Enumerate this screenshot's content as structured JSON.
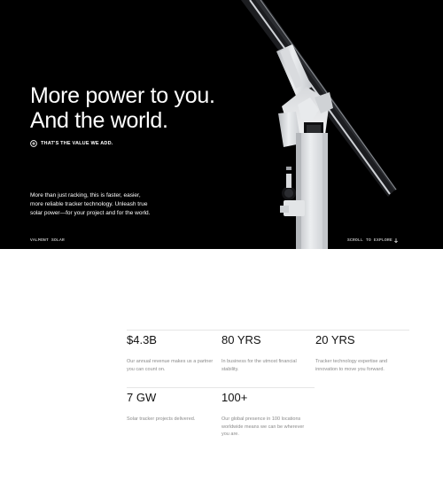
{
  "hero": {
    "headline_line1": "More power to you.",
    "headline_line2": "And the world.",
    "cta_label": "THAT'S THE VALUE WE ADD.",
    "intro_text": "More than just racking, this is faster, easier, more reliable tracker technology. Unleash true solar power—for your project and for the world.",
    "brand_label": "VALMONT SOLAR",
    "scroll_label": "SCROLL TO EXPLORE",
    "scroll_icon": "arrow-down-icon",
    "cta_icon": "circle-plus-icon",
    "background_color": "#000000"
  },
  "stats": [
    {
      "value": "$4.3B",
      "description": "Our annual revenue makes us a partner you can count on."
    },
    {
      "value": "80 YRS",
      "description": "In business for the utmost financial stability."
    },
    {
      "value": "20 YRS",
      "description": "Tracker technology expertise and innovation to move you forward."
    },
    {
      "value": "7 GW",
      "description": "Solar tracker projects delivered."
    },
    {
      "value": "100+",
      "description": "Our global presence in 100 locations worldwide means we can be wherever you are."
    }
  ]
}
